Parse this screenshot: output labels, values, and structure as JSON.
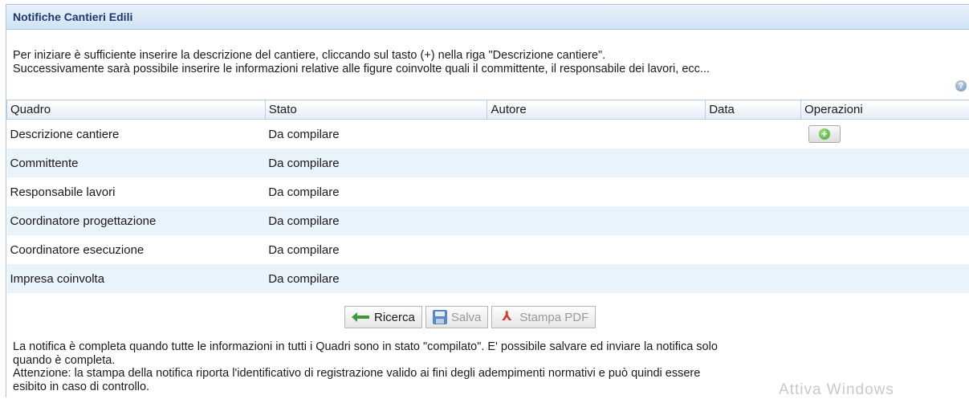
{
  "panel": {
    "title": "Notifiche Cantieri Edili"
  },
  "intro": {
    "line1": "Per iniziare è sufficiente inserire la descrizione del cantiere, cliccando sul tasto (+) nella riga \"Descrizione cantiere\".",
    "line2": "Successivamente sarà possibile inserire le informazioni relative alle figure coinvolte quali il committente, il responsabile dei lavori, ecc..."
  },
  "help_icon": "?",
  "table": {
    "headers": [
      "Quadro",
      "Stato",
      "Autore",
      "Data",
      "Operazioni"
    ],
    "rows": [
      {
        "quadro": "Descrizione cantiere",
        "stato": "Da compilare",
        "autore": "",
        "data": ""
      },
      {
        "quadro": "Committente",
        "stato": "Da compilare",
        "autore": "",
        "data": ""
      },
      {
        "quadro": "Responsabile lavori",
        "stato": "Da compilare",
        "autore": "",
        "data": ""
      },
      {
        "quadro": "Coordinatore progettazione",
        "stato": "Da compilare",
        "autore": "",
        "data": ""
      },
      {
        "quadro": "Coordinatore esecuzione",
        "stato": "Da compilare",
        "autore": "",
        "data": ""
      },
      {
        "quadro": "Impresa coinvolta",
        "stato": "Da compilare",
        "autore": "",
        "data": ""
      }
    ],
    "add_icon": "plus-circle-icon"
  },
  "toolbar": {
    "ricerca_label": "Ricerca",
    "salva_label": "Salva",
    "stampa_label": "Stampa PDF"
  },
  "footer": {
    "line1": "La notifica è completa quando tutte le informazioni in tutti i Quadri sono in stato \"compilato\". E' possibile salvare ed inviare la notifica solo",
    "line2": "quando è completa.",
    "line3": "Attenzione: la stampa della notifica riporta l'identificativo di registrazione valido ai fini degli adempimenti normativi e può quindi essere",
    "line4": "esibito in caso di controllo."
  },
  "watermark": "Attiva Windows",
  "colors": {
    "header_text": "#1b3a6b",
    "row_alt": "#e8f3fb",
    "border": "#a9c6e2"
  }
}
